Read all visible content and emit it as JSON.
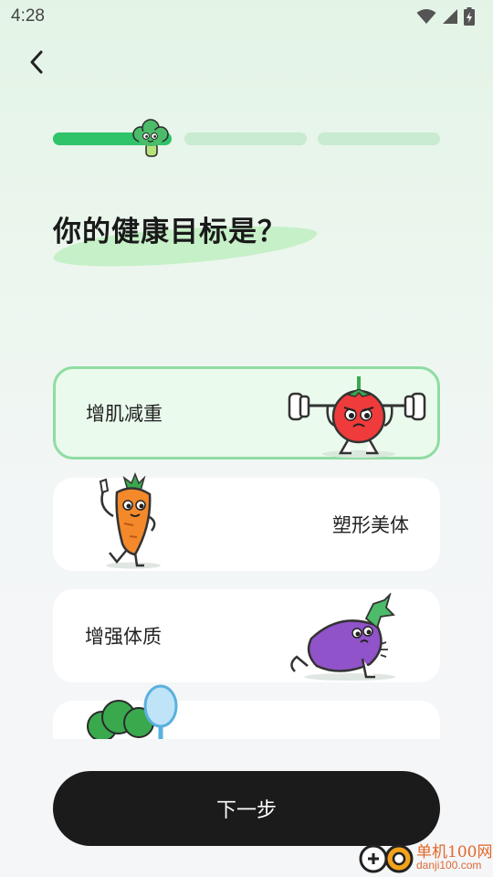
{
  "status_bar": {
    "time": "4:28",
    "icons": [
      "wifi-icon",
      "cellular-signal-icon",
      "battery-charging-icon"
    ]
  },
  "nav": {
    "back_icon": "chevron-left-icon"
  },
  "progress": {
    "steps_total": 3,
    "current_step": 1,
    "step1_fill": 1.0,
    "mascot": "broccoli-mascot-icon"
  },
  "question": {
    "title": "你的健康目标是？"
  },
  "options": [
    {
      "label": "增肌减重",
      "selected": true,
      "illustration": "tomato-weightlifting-illustration"
    },
    {
      "label": "塑形美体",
      "selected": false,
      "illustration": "carrot-flexing-illustration"
    },
    {
      "label": "增强体质",
      "selected": false,
      "illustration": "eggplant-pushup-illustration"
    },
    {
      "label": "",
      "selected": false,
      "illustration": "broccoli-illustration"
    }
  ],
  "next_button": {
    "label": "下一步"
  },
  "watermark": {
    "title": "单机100网",
    "url": "danji100.com"
  },
  "colors": {
    "accent_green": "#2fc36a",
    "selected_border": "#8fdca2",
    "button_dark": "#1b1b1b"
  }
}
